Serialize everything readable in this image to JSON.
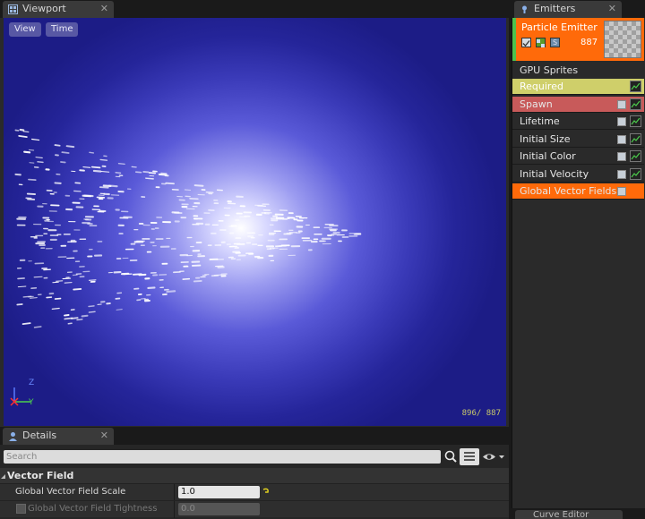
{
  "tabs": {
    "viewport": "Viewport",
    "emitters": "Emitters",
    "details": "Details",
    "curve_editor": "Curve Editor"
  },
  "viewport": {
    "view_label": "View",
    "time_label": "Time",
    "counter": "896/ 887",
    "axis_z": "Z",
    "axis_y": "Y"
  },
  "emitters": {
    "emitter_name": "Particle Emitter",
    "particle_count": "887",
    "type_label": "GPU Sprites",
    "modules": [
      {
        "label": "Required",
        "state": "yellow",
        "has_checkbox": false
      },
      {
        "label": "Spawn",
        "state": "red",
        "has_checkbox": true
      },
      {
        "label": "Lifetime",
        "state": "normal",
        "has_checkbox": true
      },
      {
        "label": "Initial Size",
        "state": "normal",
        "has_checkbox": true
      },
      {
        "label": "Initial Color",
        "state": "normal",
        "has_checkbox": true
      },
      {
        "label": "Initial Velocity",
        "state": "normal",
        "has_checkbox": true
      },
      {
        "label": "Global Vector Fields",
        "state": "orange",
        "has_checkbox": true
      }
    ]
  },
  "details": {
    "search_placeholder": "Search",
    "category": "Vector Field",
    "properties": [
      {
        "label": "Global Vector Field Scale",
        "value": "1.0",
        "enabled": true
      },
      {
        "label": "Global Vector Field Tightness",
        "value": "0.0",
        "enabled": false
      }
    ]
  },
  "colors": {
    "emitter_header": "#ff6a0a",
    "required_row": "#cfcf6a",
    "spawn_row": "#c85a5a",
    "vector_fields_row": "#ff6a0a",
    "viewport_bg": "#1c1c86"
  }
}
